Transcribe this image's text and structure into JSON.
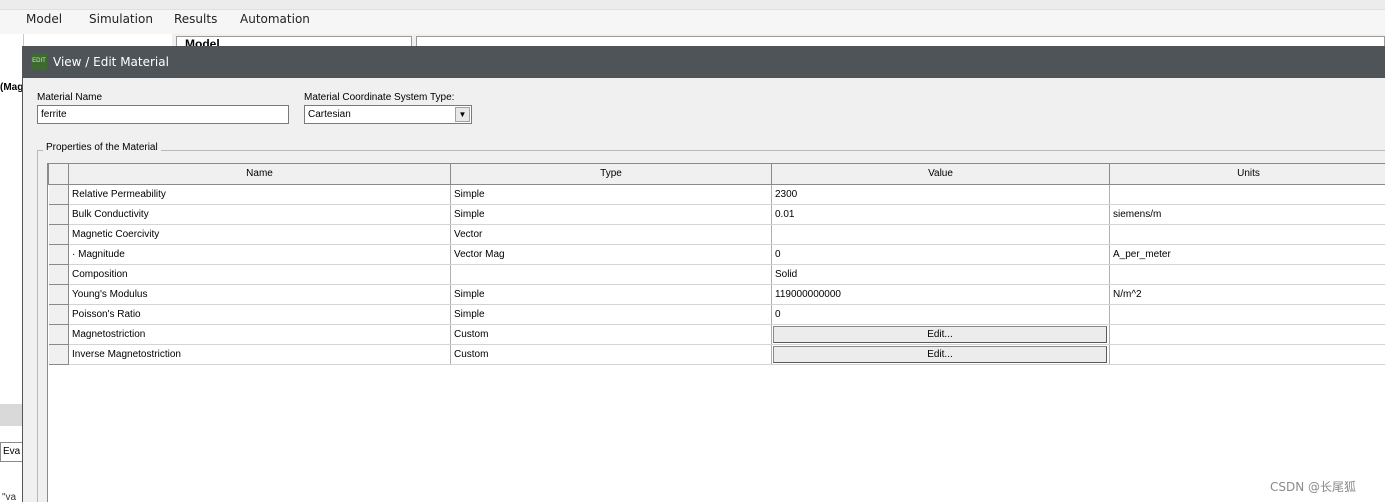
{
  "app": {
    "menu": [
      "Model",
      "Simulation",
      "Results",
      "Automation"
    ],
    "model_tab": "Model",
    "left_label": "(Mag",
    "eval_box": "Eva",
    "eval_text": "\"va"
  },
  "dialog": {
    "title": "View / Edit Material",
    "icon_text": "EDIT",
    "material_name_label": "Material Name",
    "material_name_value": "ferrite",
    "coord_label": "Material Coordinate System Type:",
    "coord_value": "Cartesian",
    "group_title": "Properties of the Material",
    "columns": [
      "Name",
      "Type",
      "Value",
      "Units"
    ],
    "rows": [
      {
        "name": "Relative Permeability",
        "type": "Simple",
        "value": "2300",
        "units": ""
      },
      {
        "name": "Bulk Conductivity",
        "type": "Simple",
        "value": "0.01",
        "units": "siemens/m"
      },
      {
        "name": "Magnetic Coercivity",
        "type": "Vector",
        "value": "",
        "units": ""
      },
      {
        "name": "·  Magnitude",
        "type": "Vector Mag",
        "value": "0",
        "units": "A_per_meter"
      },
      {
        "name": "Composition",
        "type": "",
        "value": "Solid",
        "units": ""
      },
      {
        "name": "Young's Modulus",
        "type": "Simple",
        "value": "119000000000",
        "units": "N/m^2"
      },
      {
        "name": "Poisson's Ratio",
        "type": "Simple",
        "value": "0",
        "units": ""
      },
      {
        "name": "Magnetostriction",
        "type": "Custom",
        "value": "Edit...",
        "units": ""
      },
      {
        "name": "Inverse Magnetostriction",
        "type": "Custom",
        "value": "Edit...",
        "units": ""
      }
    ]
  },
  "watermark": "CSDN @长尾狐"
}
